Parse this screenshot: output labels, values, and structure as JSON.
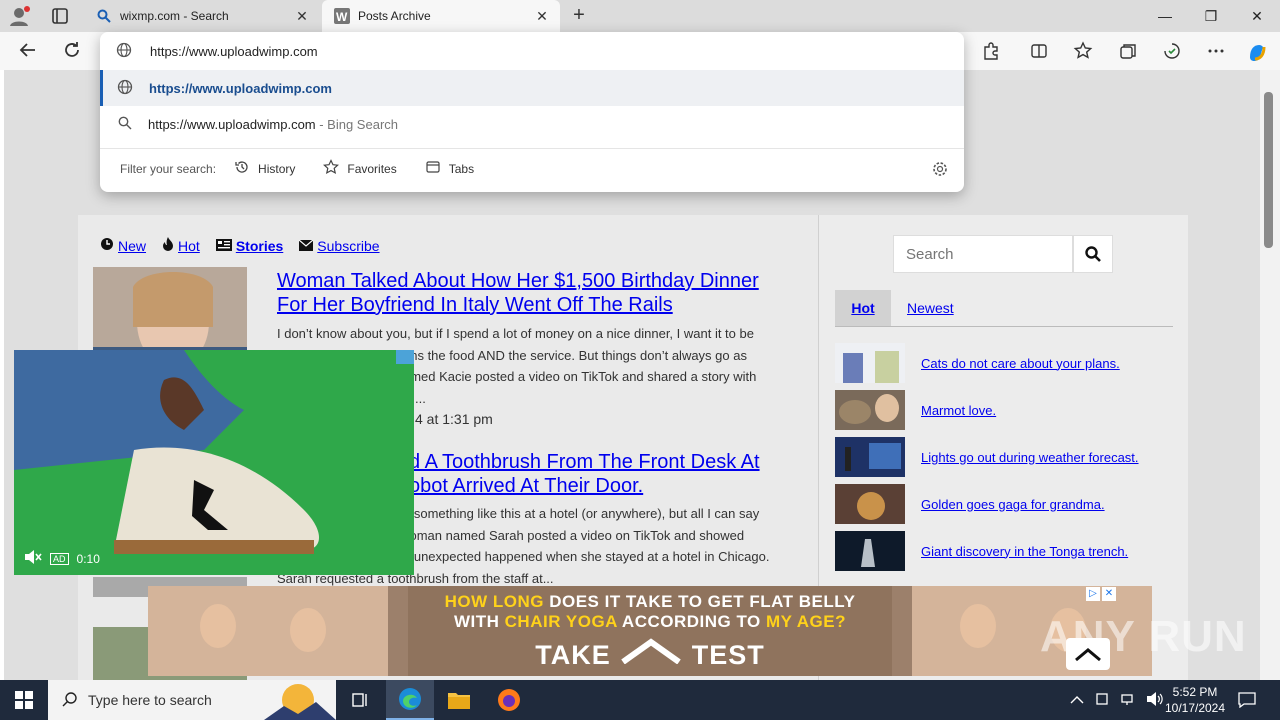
{
  "browser": {
    "tabs": [
      {
        "label": "wixmp.com - Search",
        "close": "✕"
      },
      {
        "label": "Posts Archive",
        "close": "✕"
      }
    ],
    "new_tab": "+",
    "window_controls": {
      "minimize": "—",
      "maximize": "❐",
      "close": "✕"
    }
  },
  "omnibox": {
    "url_value": "https://www.uploadwimp.com",
    "suggestion_1": "https://www.uploadwimp.com",
    "suggestion_2_text": "https://www.uploadwimp.com",
    "suggestion_2_suffix": " - Bing Search",
    "filter_label": "Filter your search:",
    "filters": {
      "history": "History",
      "favorites": "Favorites",
      "tabs": "Tabs"
    }
  },
  "site": {
    "nav": {
      "new": "New",
      "hot": "Hot",
      "stories": "Stories",
      "subscribe": "Subscribe"
    },
    "posts": [
      {
        "title": "Woman Talked About How Her $1,500 Birthday Dinner For Her Boyfriend In Italy Went Off The Rails",
        "excerpt_1": "I don’t know about you, but if I spend a lot of money on a nice dinner, I want it to be",
        "excerpt_2": "ans the food AND the service. But things don’t always go as",
        "excerpt_3": "amed Kacie posted a video on TikTok and shared a story with",
        "excerpt_4": "...",
        "date": "4 at 1:31 pm"
      },
      {
        "title_1": "d A Toothbrush From The Front Desk At",
        "title_2": "obot Arrived At Their Door.",
        "excerpt_1": "e something like this at a hotel (or anywhere), but all I can say",
        "excerpt_2": "voman named Sarah posted a video on TikTok and showed",
        "excerpt_3": "g unexpected happened when she stayed at a hotel in Chicago.",
        "excerpt_4": "Sarah requested a toothbrush from the staff at..."
      }
    ],
    "sidebar": {
      "search_placeholder": "Search",
      "tab_hot": "Hot",
      "tab_newest": "Newest",
      "items": [
        {
          "label": "Cats do not care about your plans."
        },
        {
          "label": "Marmot love."
        },
        {
          "label": "Lights go out during weather forecast."
        },
        {
          "label": "Golden goes gaga for grandma."
        },
        {
          "label": "Giant discovery in the Tonga trench."
        }
      ]
    }
  },
  "video_ad": {
    "time": "0:10",
    "ad_badge": "AD"
  },
  "banner_ad": {
    "line_1_a": "HOW LONG",
    "line_1_b": " DOES IT TAKE TO GET FLAT BELLY",
    "line_2_a": "WITH ",
    "line_2_b": "CHAIR YOGA",
    "line_2_c": " ACCORDING TO ",
    "line_2_d": "MY AGE?",
    "cta_1": "TAKE",
    "cta_2": "TEST"
  },
  "taskbar": {
    "search_placeholder": "Type here to search",
    "time": "5:52 PM",
    "date": "10/17/2024"
  },
  "watermark": "ANY RUN"
}
